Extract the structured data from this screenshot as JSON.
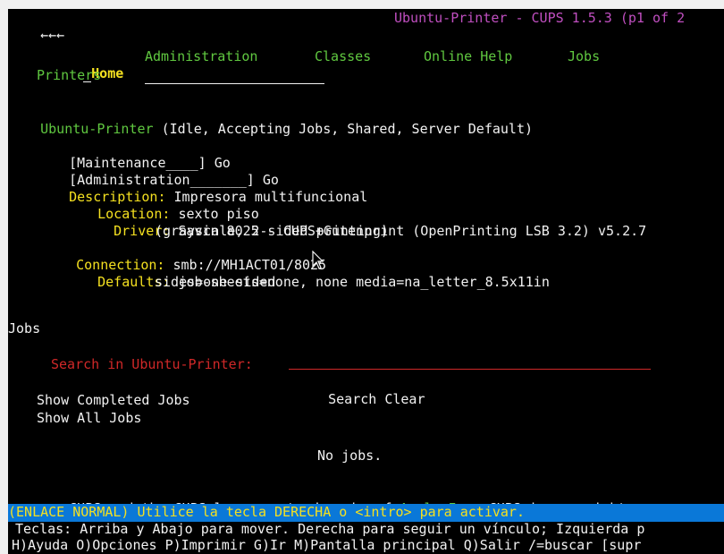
{
  "titlebar": {
    "back_glyph": "←←←",
    "title": "Ubuntu-Printer - CUPS 1.5.3 (p1 of 2"
  },
  "nav": {
    "home": "Home",
    "administration": "Administration",
    "classes": "Classes",
    "online_help": "Online Help",
    "jobs": "Jobs",
    "printers": "Printers"
  },
  "printer": {
    "name": "Ubuntu-Printer",
    "state": "(Idle, Accepting Jobs, Shared, Server Default)",
    "maintenance_select": "[Maintenance____]",
    "maintenance_go": "Go",
    "administration_select": "[Administration_______]",
    "administration_go": "Go",
    "description_label": "Description:",
    "description_value": "Impresora multifuncional",
    "location_label": "Location:",
    "location_value": "sexto piso",
    "driver_label": "Driver:",
    "driver_value": "Savin 8025 - CUPS+Gutenprint (OpenPrinting LSB 3.2) v5.2.7",
    "driver_value_cont": "(grayscale, 2-sided printing)",
    "connection_label": "Connection:",
    "connection_value": "smb://MH1ACT01/8025",
    "defaults_label": "Defaults:",
    "defaults_value": "job-sheets=none, none media=na_letter_8.5x11in",
    "defaults_value_cont": "sides=one-sided"
  },
  "jobs": {
    "heading": "Jobs",
    "search_label": "Search in Ubuntu-Printer:",
    "search_value": "",
    "search_button": "Search",
    "clear_button": "Clear",
    "show_completed": "Show Completed Jobs",
    "show_all": "Show All Jobs",
    "empty_message": "No jobs."
  },
  "footer": {
    "trademark_prefix": "CUPS and the CUPS logo are trademarks of",
    "apple_link": "Apple Inc.",
    "trademark_suffix": "CUPS is copyright"
  },
  "statusbar": {
    "link_info": "(ENLACE NORMAL) Utilice la tecla DERECHA o <intro> para activar.",
    "keys_line1": "Teclas: Arriba y Abajo para mover. Derecha para seguir un vínculo; Izquierda p",
    "keys_line2": "H)Ayuda O)Opciones P)Imprimir G)Ir M)Pantalla principal Q)Salir /=buscar [supr"
  },
  "colors": {
    "background": "#000000",
    "text": "#f2f2f2",
    "link": "#60c840",
    "label": "#f4e020",
    "title": "#c04fc0",
    "form_label": "#d02828",
    "status_bar": "#0a78d8"
  }
}
